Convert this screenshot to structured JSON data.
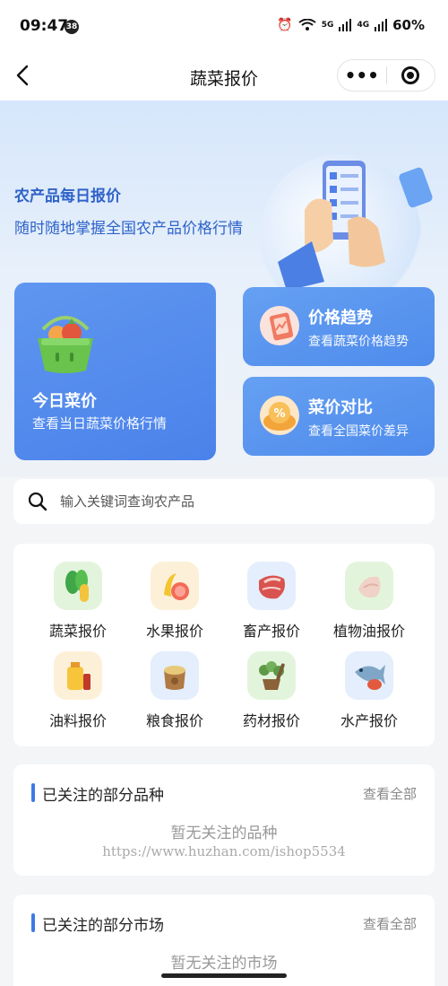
{
  "status_bar": {
    "time": "09:47",
    "notif_count": "38",
    "network_5g": "5G",
    "network_4g": "4G",
    "battery": "60%"
  },
  "navbar": {
    "back_icon": "chevron-left",
    "title": "蔬菜报价",
    "more_icon": "•••",
    "target_icon": "record-circle"
  },
  "hero": {
    "title": "农产品每日报价",
    "subtitle": "随时随地掌握全国农产品价格行情"
  },
  "cards": {
    "today": {
      "title": "今日菜价",
      "subtitle": "查看当日蔬菜价格行情",
      "icon": "basket-icon"
    },
    "trend": {
      "title": "价格趋势",
      "subtitle": "查看蔬菜价格趋势",
      "icon": "chart-icon"
    },
    "compare": {
      "title": "菜价对比",
      "subtitle": "查看全国菜价差异",
      "icon": "percent-icon"
    }
  },
  "search": {
    "placeholder": "输入关键词查询农产品"
  },
  "categories": [
    {
      "label": "蔬菜报价",
      "icon": "vegetable-icon",
      "color": "#e3f4dc"
    },
    {
      "label": "水果报价",
      "icon": "fruit-icon",
      "color": "#fdf0d8"
    },
    {
      "label": "畜产报价",
      "icon": "meat-icon",
      "color": "#e4eefc"
    },
    {
      "label": "植物油报价",
      "icon": "plant-oil-icon",
      "color": "#e3f4dc"
    },
    {
      "label": "油料报价",
      "icon": "oil-icon",
      "color": "#fdf0d8"
    },
    {
      "label": "粮食报价",
      "icon": "grain-icon",
      "color": "#e4eefc"
    },
    {
      "label": "药材报价",
      "icon": "herb-icon",
      "color": "#e3f4dc"
    },
    {
      "label": "水产报价",
      "icon": "seafood-icon",
      "color": "#e4eefc"
    }
  ],
  "followed_varieties": {
    "title": "已关注的部分品种",
    "view_all": "查看全部",
    "empty_text": "暂无关注的品种",
    "watermark": "https://www.huzhan.com/ishop5534"
  },
  "followed_markets": {
    "title": "已关注的部分市场",
    "view_all": "查看全部",
    "empty_text": "暂无关注的市场"
  },
  "colors": {
    "accent": "#3f7ae6",
    "card_blue": "#5a8fee",
    "hero_text": "#2f63c9"
  }
}
